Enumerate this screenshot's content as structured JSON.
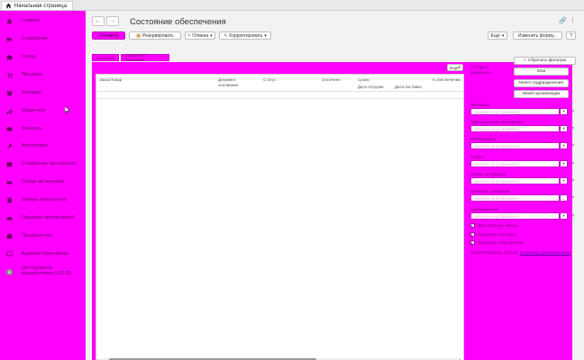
{
  "top_tab": {
    "label": "Начальная страница"
  },
  "sidebar": {
    "items": [
      {
        "label": "Главное",
        "icon": "home-icon"
      },
      {
        "label": "Снабжение",
        "icon": "truck-icon"
      },
      {
        "label": "Склад",
        "icon": "warehouse-icon"
      },
      {
        "label": "Продажи",
        "icon": "cart-icon"
      },
      {
        "label": "Розница",
        "icon": "store-icon"
      },
      {
        "label": "Маркетинг",
        "icon": "chart-icon"
      },
      {
        "label": "Финансы",
        "icon": "coins-icon"
      },
      {
        "label": "Автосервис",
        "icon": "wrench-icon"
      },
      {
        "label": "Снабжение автосалона",
        "icon": "box-icon"
      },
      {
        "label": "Склад автосалона",
        "icon": "folder-icon"
      },
      {
        "label": "Заказы автосалона",
        "icon": "doc-icon"
      },
      {
        "label": "Продажа автомобилей",
        "icon": "car-icon"
      },
      {
        "label": "Предприятие",
        "icon": "building-icon"
      },
      {
        "label": "Администрирование",
        "icon": "monitor-icon"
      },
      {
        "label_line1": "Инструменты",
        "label_line2": "разработчика 0.62.28",
        "icon": "gear-icon"
      }
    ]
  },
  "header": {
    "title": "Состояние обеспечения",
    "back": "←",
    "forward": "→"
  },
  "toolbar": {
    "refresh": "Обновить",
    "reserve": "Резервировать",
    "cancel": "Отмена",
    "correct": "Корректировать",
    "more": "Еще",
    "change_form": "Изменить форму...",
    "help": "?"
  },
  "tabs": [
    "Основное",
    "Документы-основания"
  ],
  "table": {
    "more": "Еще",
    "columns": [
      "Заказ/Товар",
      "Документ",
      "основание",
      "Статус",
      "Оплачено",
      "Сроки",
      "Дата отгрузки",
      "Дата поставки",
      "К обеспечению"
    ]
  },
  "filters": {
    "mode_label_1": "Отбирать",
    "mode_label_2": "документы",
    "reset": "Сбросить фильтры",
    "mine": "Мои",
    "my_division": "Моего подразделения",
    "my_org": "Моей организации",
    "fields": [
      {
        "label": "Менеджер:",
        "placeholder": "(фильтр не установлен)"
      },
      {
        "label": "Подразделение менеджера:",
        "placeholder": "(фильтр не установлен)"
      },
      {
        "label": "Организация:",
        "placeholder": "(фильтр не установлен)"
      },
      {
        "label": "Клиент:",
        "placeholder": "(фильтр не установлен)"
      },
      {
        "label": "Склад поставщика:",
        "placeholder": "(фильтр не установлен)"
      },
      {
        "label": "Документ основания:",
        "placeholder": "(фильтр не установлен)"
      },
      {
        "label": "Номенклатура:",
        "placeholder": "(фильтр не установлен)"
      }
    ],
    "checks": [
      {
        "label": "Действующие заказы",
        "checked": true
      },
      {
        "label": "Проверить поставки",
        "checked": true
      },
      {
        "label": "Проверить обеспечение",
        "checked": true
      }
    ],
    "additional_prefix": "Дополнительные отборы:",
    "additional_link": "Установить дополнительно"
  }
}
